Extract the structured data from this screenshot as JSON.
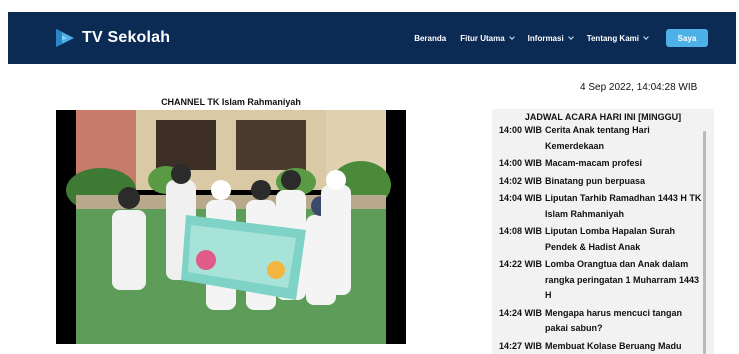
{
  "brand": {
    "name": "TV Sekolah",
    "logo_icon": "tv-sekolah-play-logo-icon"
  },
  "nav": {
    "items": [
      {
        "label": "Beranda",
        "has_dropdown": false
      },
      {
        "label": "Fitur Utama",
        "has_dropdown": true
      },
      {
        "label": "Informasi",
        "has_dropdown": true
      },
      {
        "label": "Tentang Kami",
        "has_dropdown": true
      }
    ],
    "login_label": "Saya"
  },
  "datetime": "4 Sep 2022, 14:04:28 WIB",
  "channel": {
    "title": "CHANNEL TK Islam Rahmaniyah"
  },
  "schedule": {
    "title": "JADWAL ACARA HARI INI [MINGGU]",
    "items": [
      {
        "time": "14:00 WIB",
        "name": "Cerita Anak tentang Hari Kemerdekaan"
      },
      {
        "time": "14:00 WIB",
        "name": "Macam-macam profesi"
      },
      {
        "time": "14:02 WIB",
        "name": "Binatang pun berpuasa"
      },
      {
        "time": "14:04 WIB",
        "name": "Liputan Tarhib Ramadhan 1443 H TK Islam Rahmaniyah"
      },
      {
        "time": "14:08 WIB",
        "name": "Liputan Lomba Hapalan Surah Pendek & Hadist Anak"
      },
      {
        "time": "14:22 WIB",
        "name": "Lomba Orangtua dan Anak dalam rangka peringatan 1 Muharram 1443 H"
      },
      {
        "time": "14:24 WIB",
        "name": "Mengapa harus mencuci tangan pakai sabun?"
      },
      {
        "time": "14:27 WIB",
        "name": "Membuat Kolase Beruang Madu Menggunakan Koran"
      }
    ]
  },
  "colors": {
    "navbar": "#0b2b55",
    "login_button": "#4db0e6",
    "schedule_bg": "#f2f2f2"
  }
}
